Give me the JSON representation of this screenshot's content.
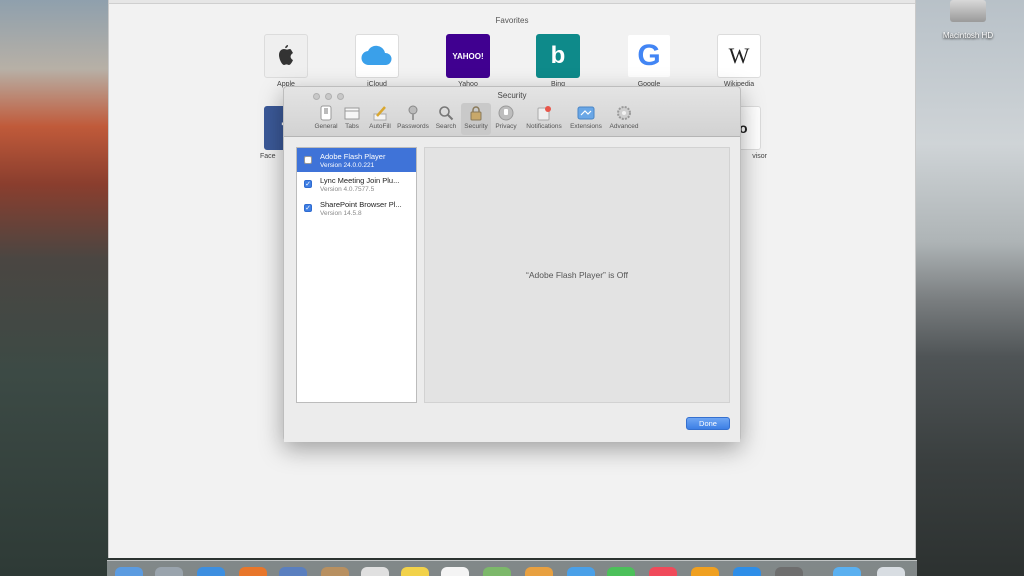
{
  "desktop": {
    "drive_label": "Macintosh HD"
  },
  "safari": {
    "favorites_title": "Favorites",
    "favorites": [
      {
        "label": "Apple",
        "icon": "apple-logo-icon",
        "bg": "#f0f0f0"
      },
      {
        "label": "iCloud",
        "icon": "cloud-icon",
        "bg": "#ffffff"
      },
      {
        "label": "Yahoo",
        "icon": "yahoo-logo-icon",
        "bg": "#400090",
        "text": "YAHOO!"
      },
      {
        "label": "Bing",
        "icon": "bing-logo-icon",
        "bg": "#0e8a8a",
        "text": "b"
      },
      {
        "label": "Google",
        "icon": "google-logo-icon",
        "bg": "#ffffff",
        "text": "G"
      },
      {
        "label": "Wikipedia",
        "icon": "wikipedia-logo-icon",
        "bg": "#ffffff",
        "text": "W"
      }
    ],
    "partial_favorites": [
      {
        "label": "Face",
        "icon": "facebook-logo-icon",
        "bg": "#3b5998",
        "text": "f"
      },
      {
        "label": "visor",
        "icon": "tripadvisor-logo-icon",
        "bg": "#ffffff",
        "text": "oo"
      }
    ]
  },
  "prefs": {
    "title": "Security",
    "tabs": [
      {
        "label": "General",
        "icon": "general-switch-icon"
      },
      {
        "label": "Tabs",
        "icon": "tabs-icon"
      },
      {
        "label": "AutoFill",
        "icon": "autofill-pencil-icon"
      },
      {
        "label": "Passwords",
        "icon": "key-icon"
      },
      {
        "label": "Search",
        "icon": "magnifier-icon"
      },
      {
        "label": "Security",
        "icon": "lock-icon",
        "active": true
      },
      {
        "label": "Privacy",
        "icon": "privacy-hand-icon"
      },
      {
        "label": "Notifications",
        "icon": "notifications-icon"
      },
      {
        "label": "Extensions",
        "icon": "extensions-puzzle-icon"
      },
      {
        "label": "Advanced",
        "icon": "gear-icon"
      }
    ],
    "plugins": [
      {
        "name": "Adobe Flash Player",
        "version": "Version 24.0.0.221",
        "checked": false,
        "selected": true
      },
      {
        "name": "Lync Meeting Join Plu...",
        "version": "Version 4.0.7577.5",
        "checked": true,
        "selected": false
      },
      {
        "name": "SharePoint Browser Pl...",
        "version": "Version 14.5.8",
        "checked": true,
        "selected": false
      }
    ],
    "detail_text": "“Adobe Flash Player” is Off",
    "done_label": "Done"
  },
  "colors": {
    "selection": "#3f73d8",
    "done_button": "#3d7fe5"
  }
}
